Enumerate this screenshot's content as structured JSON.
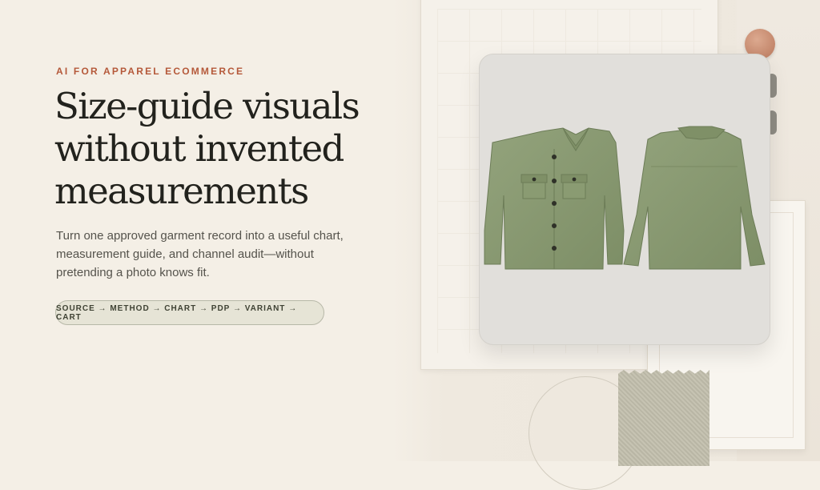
{
  "hero": {
    "eyebrow": "AI FOR APPAREL ECOMMERCE",
    "headline_lines": [
      "Size-guide visuals",
      "without invented",
      "measurements"
    ],
    "body_lines": [
      "Turn one approved garment record into a useful chart,",
      "measurement guide, and channel audit—without",
      "pretending a photo knows fit."
    ],
    "flow_pill": "SOURCE → METHOD → CHART → PDP → VARIANT → CART"
  },
  "product_card": {
    "image_subject": "olive overshirt front and back",
    "garment_color": "#8a9b72"
  },
  "colors": {
    "background": "#f4efe6",
    "accent": "#b5593a",
    "headline": "#22221d"
  }
}
